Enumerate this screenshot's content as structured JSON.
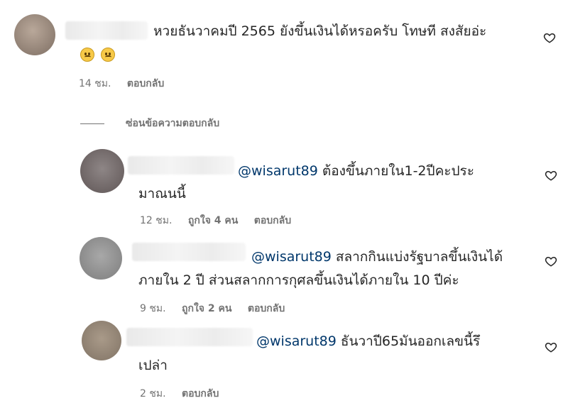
{
  "comment1": {
    "text": "หวยธันวาคมปี 2565 ยังขึ้นเงินได้หรอครับ โทษที สงสัยอ่ะ",
    "time": "14 ชม.",
    "reply_label": "ตอบกลับ"
  },
  "hide_replies": "ซ่อนข้อความตอบกลับ",
  "replies": [
    {
      "mention": "@wisarut89",
      "text_line1": " ต้องขึ้นภายใน1-2ปีคะประ",
      "text_line2": "มาณนนี้",
      "time": "12 ชม.",
      "likes": "ถูกใจ 4 คน",
      "reply_label": "ตอบกลับ"
    },
    {
      "mention": "@wisarut89",
      "text_line1": " สลากกินแบ่งรัฐบาลขึ้นเงินได้",
      "text_line2": "ภายใน 2 ปี ส่วนสลากการกุศลขึ้นเงินได้ภายใน 10 ปีค่ะ",
      "time": "9 ชม.",
      "likes": "ถูกใจ 2 คน",
      "reply_label": "ตอบกลับ"
    },
    {
      "mention": "@wisarut89",
      "text_line1": " ธันวาปี65มันออกเลขนี้รึ",
      "text_line2": "เปล่า",
      "time": "2 ชม.",
      "reply_label": "ตอบกลับ"
    }
  ],
  "colors": {
    "mention": "#00376b",
    "meta": "#737373",
    "text": "#262626"
  },
  "icons": {
    "like": "heart-outline-icon",
    "emoji": "worried-face-emoji"
  }
}
